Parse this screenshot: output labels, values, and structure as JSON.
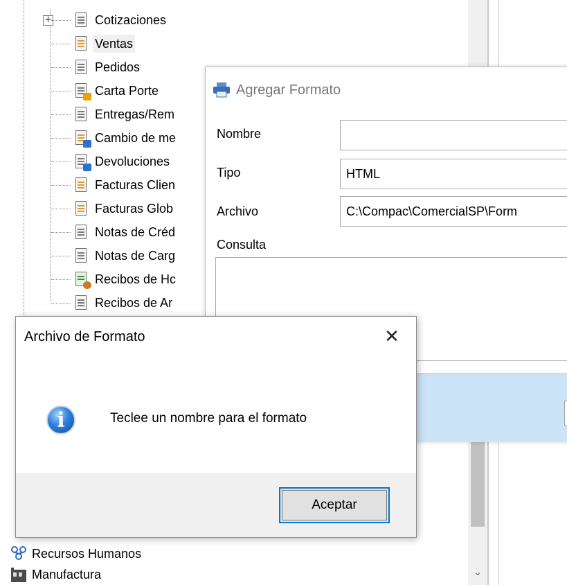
{
  "tree": {
    "items": [
      {
        "label": "Cotizaciones",
        "icon": "table-doc-icon"
      },
      {
        "label": "Ventas",
        "icon": "sales-doc-icon"
      },
      {
        "label": "Pedidos",
        "icon": "order-doc-icon"
      },
      {
        "label": "Carta Porte",
        "icon": "waybill-doc-icon"
      },
      {
        "label": "Entregas/Rem",
        "icon": "delivery-doc-icon"
      },
      {
        "label": "Cambio de me",
        "icon": "exchange-doc-icon"
      },
      {
        "label": "Devoluciones",
        "icon": "return-doc-icon"
      },
      {
        "label": "Facturas Clien",
        "icon": "invoice-doc-icon"
      },
      {
        "label": "Facturas Glob",
        "icon": "global-invoice-doc-icon"
      },
      {
        "label": "Notas de Créd",
        "icon": "credit-note-doc-icon"
      },
      {
        "label": "Notas de Carg",
        "icon": "charge-note-doc-icon"
      },
      {
        "label": "Recibos de Hc",
        "icon": "payroll-receipt-icon"
      },
      {
        "label": "Recibos de Ar",
        "icon": "lease-receipt-icon"
      }
    ],
    "roots": [
      {
        "label": "Recursos Humanos",
        "icon": "people-icon"
      },
      {
        "label": "Manufactura",
        "icon": "factory-icon"
      }
    ],
    "expander": "+"
  },
  "agregar_formato": {
    "title": "Agregar Formato",
    "icon": "printer-icon",
    "nombre_label": "Nombre",
    "nombre_value": "",
    "tipo_label": "Tipo",
    "tipo_value": "HTML",
    "archivo_label": "Archivo",
    "archivo_value": "C:\\Compac\\ComercialSP\\Form",
    "consulta_label": "Consulta",
    "consulta_value": ""
  },
  "message_box": {
    "title": "Archivo de Formato",
    "close_glyph": "✕",
    "icon": "info-icon",
    "message": "Teclee un nombre para el formato",
    "ok_label": "Aceptar"
  },
  "colors": {
    "accent": "#0078d7",
    "strip": "#cce4f7"
  }
}
